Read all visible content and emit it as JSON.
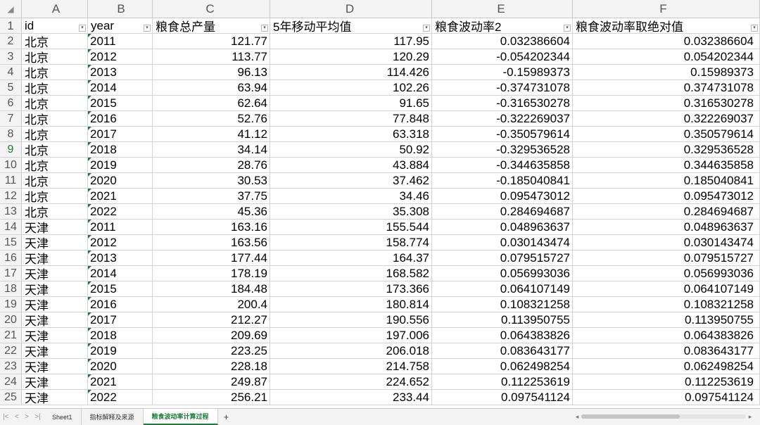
{
  "columns": [
    "A",
    "B",
    "C",
    "D",
    "E",
    "F"
  ],
  "corner_icon": "select-all-triangle",
  "headers": [
    "id",
    "year",
    "粮食总产量",
    "5年移动平均值",
    "粮食波动率2",
    "粮食波动率取绝对值"
  ],
  "rows": [
    [
      "北京",
      "2011",
      "121.77",
      "117.95",
      "0.032386604",
      "0.032386604"
    ],
    [
      "北京",
      "2012",
      "113.77",
      "120.29",
      "-0.054202344",
      "0.054202344"
    ],
    [
      "北京",
      "2013",
      "96.13",
      "114.426",
      "-0.15989373",
      "0.15989373"
    ],
    [
      "北京",
      "2014",
      "63.94",
      "102.26",
      "-0.374731078",
      "0.374731078"
    ],
    [
      "北京",
      "2015",
      "62.64",
      "91.65",
      "-0.316530278",
      "0.316530278"
    ],
    [
      "北京",
      "2016",
      "52.76",
      "77.848",
      "-0.322269037",
      "0.322269037"
    ],
    [
      "北京",
      "2017",
      "41.12",
      "63.318",
      "-0.350579614",
      "0.350579614"
    ],
    [
      "北京",
      "2018",
      "34.14",
      "50.92",
      "-0.329536528",
      "0.329536528"
    ],
    [
      "北京",
      "2019",
      "28.76",
      "43.884",
      "-0.344635858",
      "0.344635858"
    ],
    [
      "北京",
      "2020",
      "30.53",
      "37.462",
      "-0.185040841",
      "0.185040841"
    ],
    [
      "北京",
      "2021",
      "37.75",
      "34.46",
      "0.095473012",
      "0.095473012"
    ],
    [
      "北京",
      "2022",
      "45.36",
      "35.308",
      "0.284694687",
      "0.284694687"
    ],
    [
      "天津",
      "2011",
      "163.16",
      "155.544",
      "0.048963637",
      "0.048963637"
    ],
    [
      "天津",
      "2012",
      "163.56",
      "158.774",
      "0.030143474",
      "0.030143474"
    ],
    [
      "天津",
      "2013",
      "177.44",
      "164.37",
      "0.079515727",
      "0.079515727"
    ],
    [
      "天津",
      "2014",
      "178.19",
      "168.582",
      "0.056993036",
      "0.056993036"
    ],
    [
      "天津",
      "2015",
      "184.48",
      "173.366",
      "0.064107149",
      "0.064107149"
    ],
    [
      "天津",
      "2016",
      "200.4",
      "180.814",
      "0.108321258",
      "0.108321258"
    ],
    [
      "天津",
      "2017",
      "212.27",
      "190.556",
      "0.113950755",
      "0.113950755"
    ],
    [
      "天津",
      "2018",
      "209.69",
      "197.006",
      "0.064383826",
      "0.064383826"
    ],
    [
      "天津",
      "2019",
      "223.25",
      "206.018",
      "0.083643177",
      "0.083643177"
    ],
    [
      "天津",
      "2020",
      "228.18",
      "214.758",
      "0.062498254",
      "0.062498254"
    ],
    [
      "天津",
      "2021",
      "249.87",
      "224.652",
      "0.112253619",
      "0.112253619"
    ],
    [
      "天津",
      "2022",
      "256.21",
      "233.44",
      "0.097541124",
      "0.097541124"
    ]
  ],
  "selected_row": 9,
  "sheet_tabs": [
    {
      "label": "Sheet1",
      "active": false
    },
    {
      "label": "指标解释及来源",
      "active": false
    },
    {
      "label": "粮食波动率计算过程",
      "active": true
    }
  ],
  "add_sheet_label": "+",
  "nav_icons": [
    "first-sheet-icon",
    "prev-sheet-icon",
    "next-sheet-icon",
    "last-sheet-icon"
  ],
  "nav_glyphs": [
    "|<",
    "<",
    ">",
    ">|"
  ],
  "accent_color": "#1e7a3a"
}
